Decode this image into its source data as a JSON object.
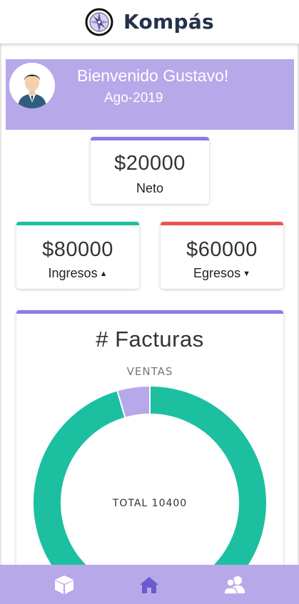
{
  "header": {
    "title": "Kompás",
    "logo_icon": "compass-icon"
  },
  "welcome": {
    "greeting": "Bienvenido Gustavo!",
    "period": "Ago-2019",
    "avatar_icon": "user-avatar-icon"
  },
  "summary": {
    "neto": {
      "amount": "$20000",
      "label": "Neto",
      "accent": "#8e7ae6"
    },
    "ingresos": {
      "amount": "$80000",
      "label": "Ingresos",
      "accent": "#1cc0a0",
      "caret_icon": "caret-up-icon"
    },
    "egresos": {
      "amount": "$60000",
      "label": "Egresos",
      "accent": "#ee5252",
      "caret_icon": "caret-down-icon"
    }
  },
  "facturas": {
    "title": "# Facturas",
    "chart_data": {
      "type": "pie",
      "title": "# Facturas",
      "series": [
        {
          "name": "VENTAS",
          "color": "#1cc0a0",
          "value": 95.5
        },
        {
          "name": "",
          "color": "#b7a8ea",
          "value": 4.5
        }
      ],
      "labels": [
        "VENTAS"
      ],
      "center_label": "TOTAL 10400"
    }
  },
  "bottom_nav": [
    {
      "icon": "cube-icon"
    },
    {
      "icon": "home-icon"
    },
    {
      "icon": "users-icon"
    }
  ],
  "colors": {
    "primary": "#b7a8ea",
    "teal": "#1cc0a0",
    "red": "#ee5252",
    "purple": "#8e7ae6"
  }
}
